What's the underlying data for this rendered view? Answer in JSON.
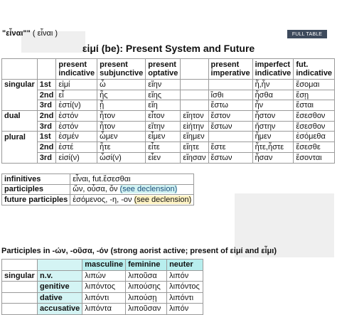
{
  "headword": {
    "word": "\"εἶναι\"\"",
    "gloss": "( εἶναι )"
  },
  "full_table_label": "FULL TABLE",
  "table_title": "εἰμί (be): Present System and Future",
  "conj": {
    "headers": [
      "present indicative",
      "present subjunctive",
      "present optative",
      "",
      "present imperative",
      "imperfect indicative",
      "fut. indicative"
    ],
    "rows": [
      {
        "group": "singular",
        "num": "1st",
        "cells": [
          "εἰμί",
          "ὦ",
          "εἴην",
          "",
          "",
          "ἦ,ἦν",
          "ἔσομαι"
        ]
      },
      {
        "group": "",
        "num": "2nd",
        "cells": [
          "εἶ",
          "ἦς",
          "εἴης",
          "",
          "ἴσθι",
          "ἦσθα",
          "ἔσῃ"
        ]
      },
      {
        "group": "",
        "num": "3rd",
        "cells": [
          "ἐστί(ν)",
          "ᾖ",
          "εἴη",
          "",
          "ἔστω",
          "ἦν",
          "ἔσται"
        ]
      },
      {
        "group": "dual",
        "num": "2nd",
        "cells": [
          "ἐστόν",
          "ἦτον",
          "εἶτον",
          "εἴητον",
          "ἔστον",
          "ἦστον",
          "ἔσεσθον"
        ]
      },
      {
        "group": "",
        "num": "3rd",
        "cells": [
          "ἐστόν",
          "ἦτον",
          "εἴτην",
          "εἰήτην",
          "ἔστων",
          "ἤστην",
          "ἔσεσθον"
        ]
      },
      {
        "group": "plural",
        "num": "1st",
        "cells": [
          "ἐσμέν",
          "ὦμεν",
          "εἶμεν",
          "εἴημεν",
          "",
          "ἦμεν",
          "ἐσόμεθα"
        ]
      },
      {
        "group": "",
        "num": "2nd",
        "cells": [
          "ἐστέ",
          "ἦτε",
          "εἶτε",
          "εἴητε",
          "ἔστε",
          "ἦτε,ἦστε",
          "ἔσεσθε"
        ]
      },
      {
        "group": "",
        "num": "3rd",
        "cells": [
          "εἰσί(ν)",
          "ὦσί(ν)",
          "εἶεν",
          "εἴησαν",
          "ἔστων",
          "ἦσαν",
          "ἔσονται"
        ]
      }
    ]
  },
  "misc": {
    "infinitives": {
      "label": "infinitives",
      "value": "εἶναι, fut.ἔσεσθαι"
    },
    "participles": {
      "label": "participles",
      "value": "ὤν, οὖσα, ὄν",
      "link": "(see declension)"
    },
    "future_participles": {
      "label": "future participles",
      "value": "ἐσόμενος, -η, -ον",
      "link": "(see declension)"
    }
  },
  "participle_heading": "Participles in -ών, -οῦσα, -όν (strong aorist active; present of εἰμί and εἶμι)",
  "participle_table": {
    "headers": [
      "masculine",
      "feminine",
      "neuter"
    ],
    "rows": [
      {
        "number": "singular",
        "case": "n.v.",
        "cells": [
          "λιπών",
          "λιποῦσα",
          "λιπόν"
        ]
      },
      {
        "number": "",
        "case": "genitive",
        "cells": [
          "λιπόντος",
          "λιπούσης",
          "λιπόντος"
        ]
      },
      {
        "number": "",
        "case": "dative",
        "cells": [
          "λιπόντι",
          "λιπούσῃ",
          "λιπόντι"
        ]
      },
      {
        "number": "",
        "case": "accusative",
        "cells": [
          "λιπόντα",
          "λιποῦσαν",
          "λιπόν"
        ]
      }
    ]
  }
}
